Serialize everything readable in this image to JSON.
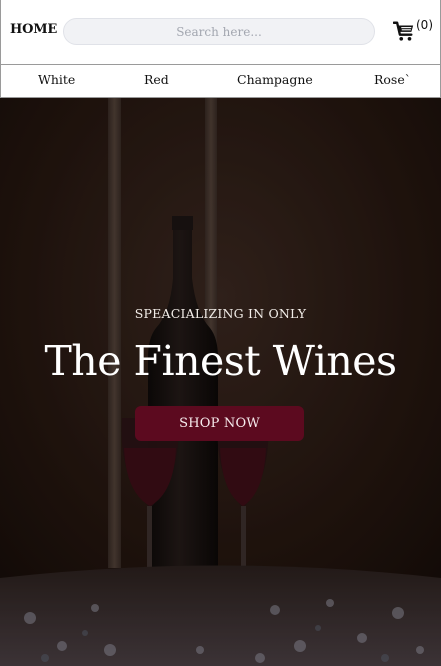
{
  "header": {
    "home_label": "HOME",
    "search": {
      "placeholder": "Search here...",
      "value": ""
    },
    "cart": {
      "icon": "cart-icon",
      "count_label": "(0)"
    }
  },
  "categories": [
    {
      "label": "White"
    },
    {
      "label": "Red"
    },
    {
      "label": "Champagne"
    },
    {
      "label": "Rose`"
    }
  ],
  "hero": {
    "kicker": "SPEACIALIZING IN ONLY",
    "title": "The Finest Wines",
    "cta_label": "SHOP NOW",
    "background": "dark photo of a wine bottle, two wine glasses and candles on a table",
    "colors": {
      "cta_background": "#5c0a1f",
      "text": "#ffffff"
    }
  }
}
